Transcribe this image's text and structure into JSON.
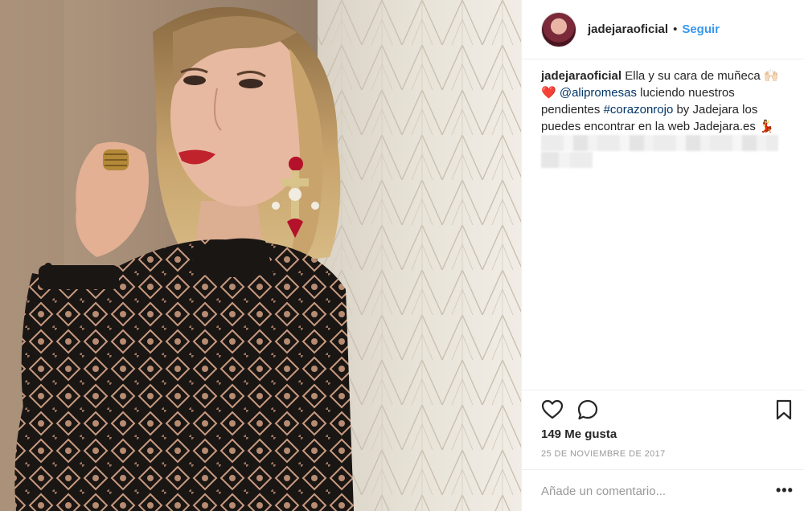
{
  "post": {
    "username": "jadejaraoficial",
    "separator": "•",
    "follow_label": "Seguir",
    "avatar": "profile-avatar"
  },
  "caption": {
    "username": "jadejaraoficial",
    "text_1": "Ella y su cara de muñeca",
    "emoji_1": "🙌🏻❤️",
    "mention": "@alipromesas",
    "text_2": "luciendo nuestros pendientes",
    "hashtag": "#corazonrojo",
    "text_3": "by Jadejara los puedes encontrar en la web Jadejara.es",
    "emoji_2": "💃"
  },
  "actions": {
    "like_icon": "heart-icon",
    "comment_icon": "comment-icon",
    "save_icon": "bookmark-icon"
  },
  "likes": "149 Me gusta",
  "date": "25 DE NOVIEMBRE DE 2017",
  "comment": {
    "placeholder": "Añade un comentario...",
    "more": "•••"
  },
  "colors": {
    "accent": "#3897f0",
    "link": "#003569",
    "muted": "#999999",
    "border": "#efefef"
  }
}
